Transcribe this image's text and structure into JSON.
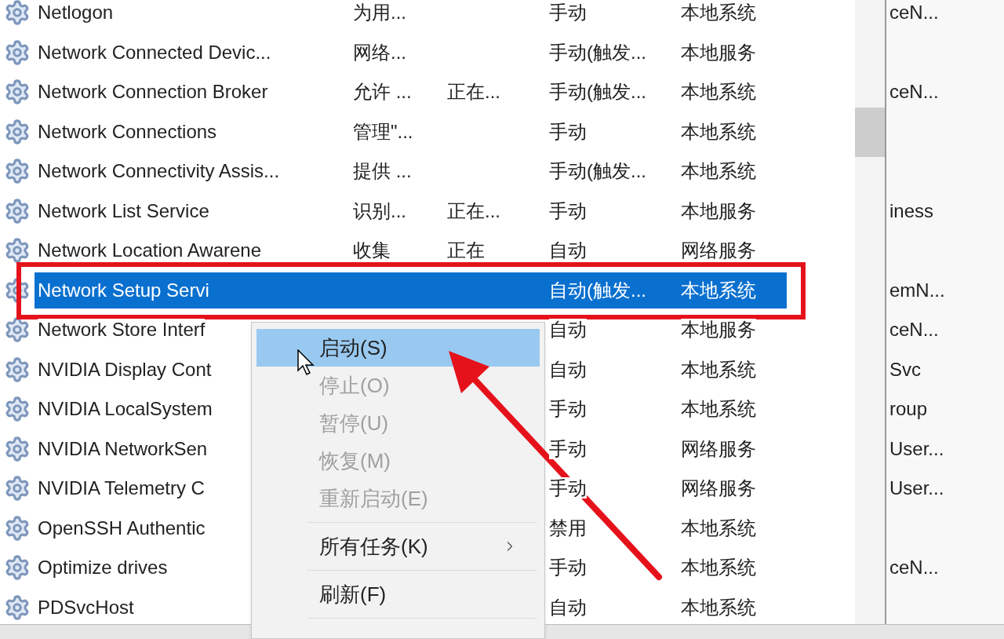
{
  "rows": [
    {
      "name": "Netlogon",
      "description": "为用...",
      "startup": "手动",
      "logon": "本地系统",
      "extra": "ceN...",
      "selected": false
    },
    {
      "name": "Network Connected Devic...",
      "description": "网络...",
      "startup": "手动(触发...",
      "logon": "本地服务",
      "selected": false
    },
    {
      "name": "Network Connection Broker",
      "description": "允许 ...",
      "status": "正在...",
      "startup": "手动(触发...",
      "logon": "本地系统",
      "extra": "ceN...",
      "selected": false
    },
    {
      "name": "Network Connections",
      "description": "管理\"...",
      "startup": "手动",
      "logon": "本地系统",
      "selected": false
    },
    {
      "name": "Network Connectivity Assis...",
      "description": "提供 ...",
      "startup": "手动(触发...",
      "logon": "本地系统",
      "selected": false
    },
    {
      "name": "Network List Service",
      "description": "识别...",
      "status": "正在...",
      "startup": "手动",
      "logon": "本地服务",
      "extra": "iness",
      "selected": false
    },
    {
      "name": "Network Location Awarene",
      "description": "收集",
      "status": "正在",
      "startup": "自动",
      "logon": "网络服务",
      "selected": false
    },
    {
      "name": "Network Setup Servi",
      "startup": "自动(触发...",
      "logon": "本地系统",
      "extra": "emN...",
      "selected": true
    },
    {
      "name": "Network Store Interf",
      "startup": "自动",
      "logon": "本地服务",
      "extra": "ceN...",
      "selected": false
    },
    {
      "name": "NVIDIA Display Cont",
      "startup": "自动",
      "logon": "本地系统",
      "extra": "Svc",
      "selected": false
    },
    {
      "name": "NVIDIA LocalSystem",
      "startup": "手动",
      "logon": "本地系统",
      "extra": "roup",
      "selected": false
    },
    {
      "name": "NVIDIA NetworkSen",
      "startup": "手动",
      "logon": "网络服务",
      "extra": "User...",
      "selected": false
    },
    {
      "name": "NVIDIA Telemetry C",
      "startup": "手动",
      "logon": "网络服务",
      "extra": "User...",
      "selected": false
    },
    {
      "name": "OpenSSH Authentic",
      "startup": "禁用",
      "logon": "本地系统",
      "selected": false
    },
    {
      "name": "Optimize drives",
      "startup": "手动",
      "logon": "本地系统",
      "extra": "ceN...",
      "selected": false
    },
    {
      "name": "PDSvcHost",
      "startup": "自动",
      "logon": "本地系统",
      "selected": false
    }
  ],
  "context_menu": [
    {
      "kind": "item",
      "label": "启动(S)",
      "disabled": false,
      "selected": true
    },
    {
      "kind": "item",
      "label": "停止(O)",
      "disabled": true,
      "selected": false
    },
    {
      "kind": "item",
      "label": "暂停(U)",
      "disabled": true,
      "selected": false
    },
    {
      "kind": "item",
      "label": "恢复(M)",
      "disabled": true,
      "selected": false
    },
    {
      "kind": "item",
      "label": "重新启动(E)",
      "disabled": true,
      "selected": false
    },
    {
      "kind": "separator"
    },
    {
      "kind": "submenu",
      "label": "所有任务(K)",
      "disabled": false,
      "selected": false
    },
    {
      "kind": "separator"
    },
    {
      "kind": "item",
      "label": "刷新(F)",
      "disabled": false,
      "selected": false
    },
    {
      "kind": "separator"
    }
  ]
}
